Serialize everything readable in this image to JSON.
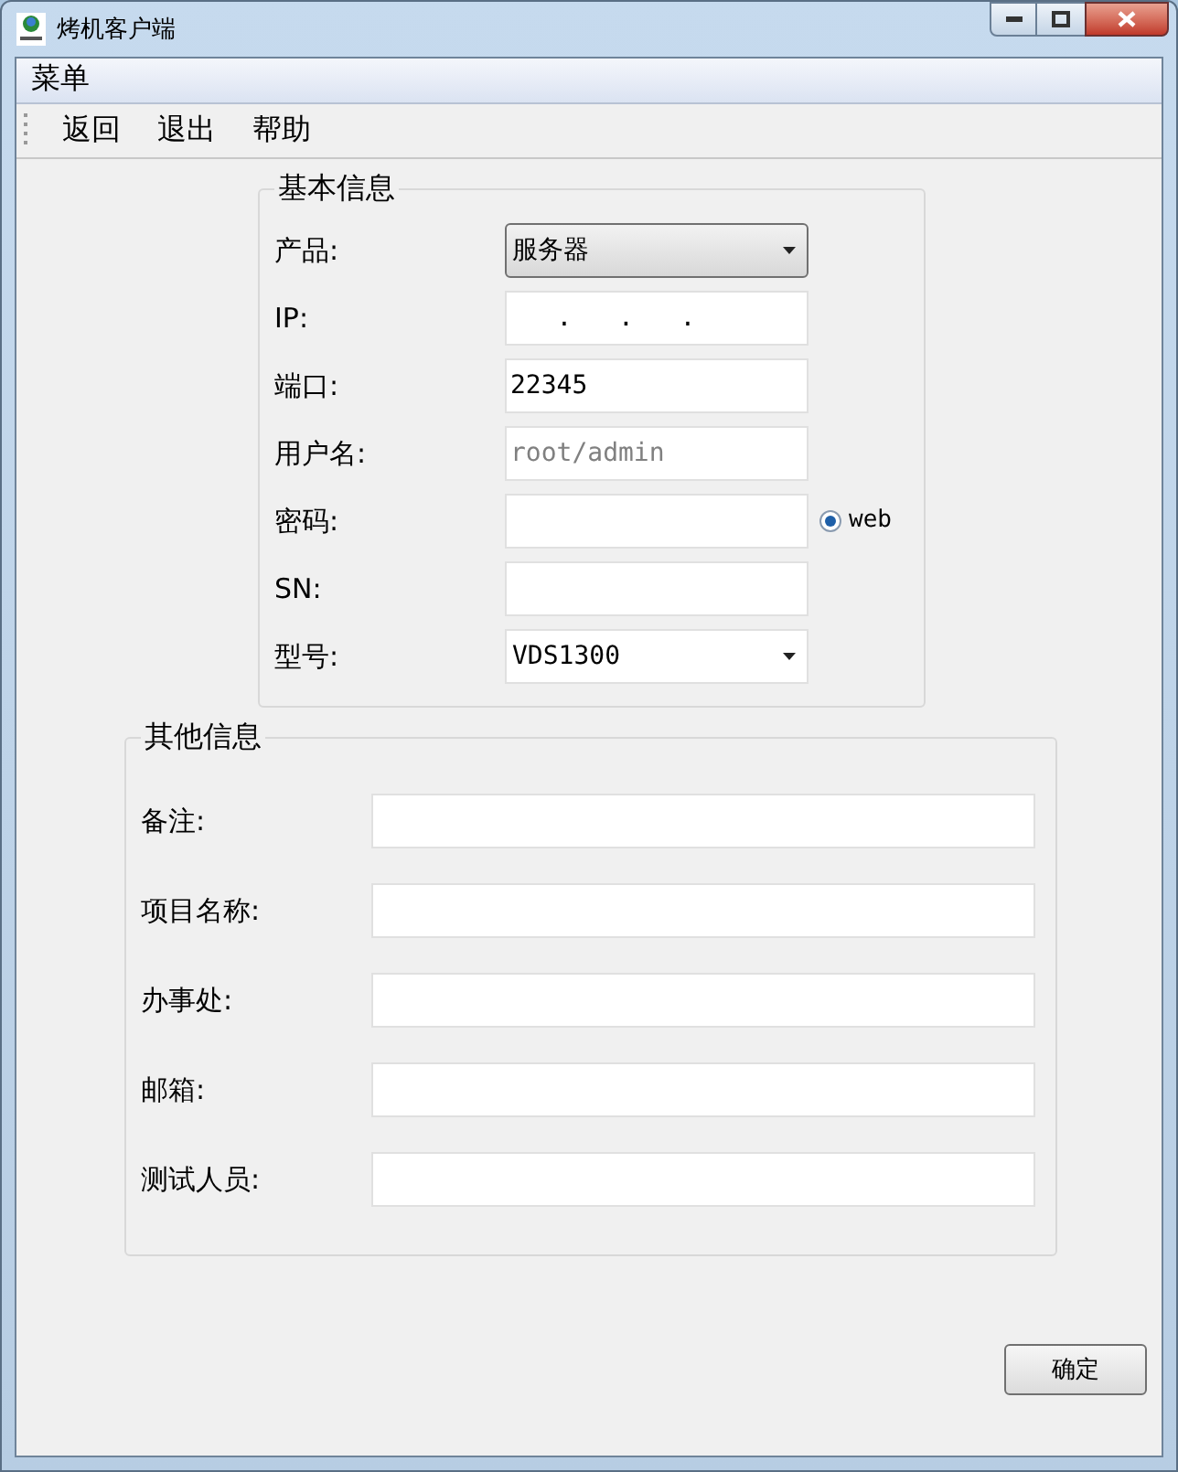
{
  "window": {
    "title": "烤机客户端"
  },
  "menu": {
    "title": "菜单"
  },
  "toolbar": [
    "返回",
    "退出",
    "帮助"
  ],
  "basic_info": {
    "title": "基本信息",
    "fields": [
      {
        "label": "产品:",
        "kind": "select",
        "value": "服务器"
      },
      {
        "label": "IP:",
        "kind": "input",
        "value": "   .   .   ."
      },
      {
        "label": "端口:",
        "kind": "input",
        "value": "22345"
      },
      {
        "label": "用户名:",
        "kind": "input",
        "placeholder": "root/admin"
      },
      {
        "label": "密码:",
        "kind": "input",
        "radio": {
          "label": "web",
          "selected": true
        }
      },
      {
        "label": "SN:",
        "kind": "input"
      },
      {
        "label": "型号:",
        "kind": "select",
        "value": "VDS1300"
      }
    ]
  },
  "other_info": {
    "title": "其他信息",
    "fields": [
      {
        "label": "备注:",
        "kind": "input"
      },
      {
        "label": "项目名称:",
        "kind": "input"
      },
      {
        "label": "办事处:",
        "kind": "input"
      },
      {
        "label": "邮箱:",
        "kind": "input"
      },
      {
        "label": "测试人员:",
        "kind": "input"
      }
    ]
  },
  "ok_button": "确定"
}
